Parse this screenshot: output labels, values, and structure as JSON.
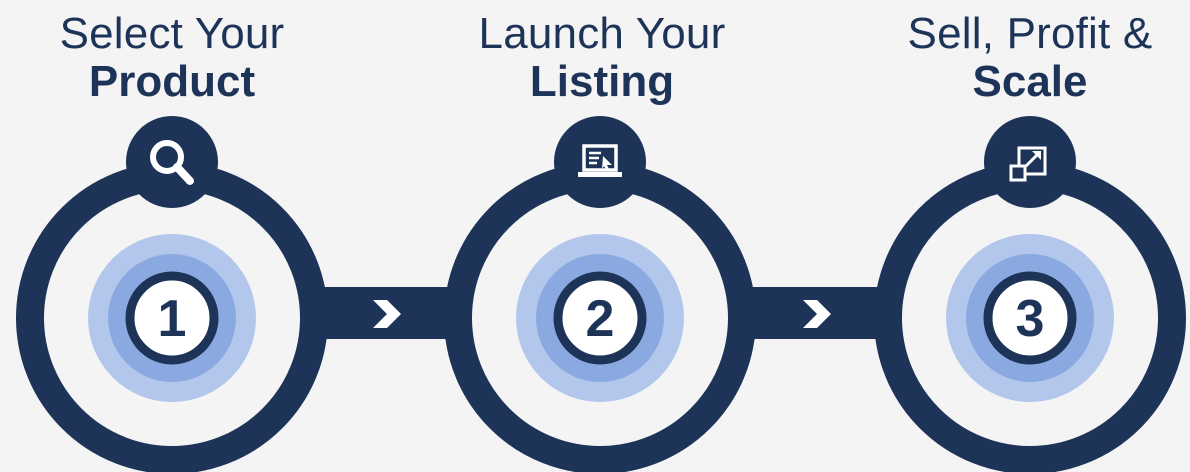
{
  "colors": {
    "background": "#f4f4f4",
    "navy": "#1d3458",
    "halo_outer": "#b3c7ec",
    "halo_mid": "#8aa9e1",
    "halo_inner": "#7197d8",
    "white": "#ffffff"
  },
  "steps": [
    {
      "number": "1",
      "title_line1": "Select Your",
      "title_line2": "Product",
      "icon": "search-icon"
    },
    {
      "number": "2",
      "title_line1": "Launch Your",
      "title_line2": "Listing",
      "icon": "laptop-listing-icon"
    },
    {
      "number": "3",
      "title_line1": "Sell, Profit &",
      "title_line2": "Scale",
      "icon": "scale-expand-icon"
    }
  ],
  "connectors": [
    {
      "icon": "chevron-right-icon"
    },
    {
      "icon": "chevron-right-icon"
    }
  ]
}
